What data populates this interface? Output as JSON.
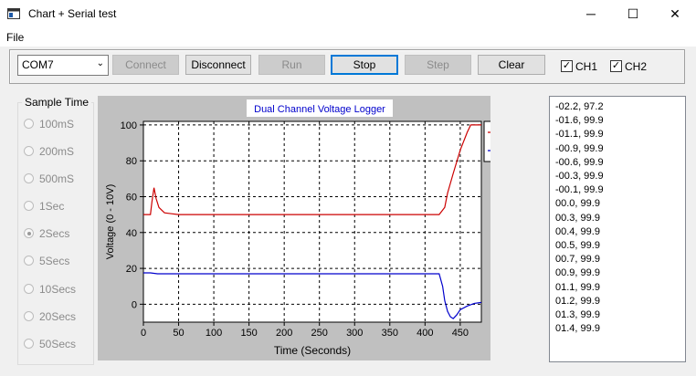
{
  "window": {
    "title": "Chart + Serial test",
    "minimize_glyph": "─",
    "maximize_glyph": "☐",
    "close_glyph": "✕"
  },
  "menu": {
    "file": "File"
  },
  "toolbar": {
    "port_value": "COM7",
    "connect": "Connect",
    "disconnect": "Disconnect",
    "run": "Run",
    "stop": "Stop",
    "step": "Step",
    "clear": "Clear",
    "ch1": "CH1",
    "ch2": "CH2",
    "ch1_checked": true,
    "ch2_checked": true
  },
  "sample_time": {
    "title": "Sample Time",
    "options": [
      "100mS",
      "200mS",
      "500mS",
      "1Sec",
      "2Secs",
      "5Secs",
      "10Secs",
      "20Secs",
      "50Secs"
    ],
    "selected": "2Secs"
  },
  "serial_log": [
    "-02.2, 97.2",
    "-01.6, 99.9",
    "-01.1, 99.9",
    "-00.9, 99.9",
    "-00.6, 99.9",
    "-00.3, 99.9",
    "-00.1, 99.9",
    "00.0, 99.9",
    "00.3, 99.9",
    "00.4, 99.9",
    "00.5, 99.9",
    "00.7, 99.9",
    "00.9, 99.9",
    "01.1, 99.9",
    "01.2, 99.9",
    "01.3, 99.9",
    "01.4, 99.9"
  ],
  "chart_data": {
    "type": "line",
    "title": "Dual Channel Voltage Logger",
    "xlabel": "Time (Seconds)",
    "ylabel": "Voltage (0 - 10V)",
    "xlim": [
      0,
      480
    ],
    "ylim": [
      -10,
      102
    ],
    "x_ticks": [
      0,
      50,
      100,
      150,
      200,
      250,
      300,
      350,
      400,
      450
    ],
    "y_ticks": [
      0,
      20,
      40,
      60,
      80,
      100
    ],
    "grid": true,
    "legend_position": "top-right",
    "series": [
      {
        "name": "CH1",
        "color": "#cc0000",
        "x": [
          0,
          10,
          12,
          15,
          18,
          22,
          30,
          40,
          50,
          100,
          200,
          300,
          420,
          428,
          432,
          440,
          450,
          460,
          465,
          470,
          480
        ],
        "y": [
          50,
          50,
          57,
          65,
          59,
          54,
          51,
          50.5,
          50,
          50,
          50,
          50,
          50,
          54,
          62,
          73,
          86,
          96,
          100,
          100,
          100
        ]
      },
      {
        "name": "CH2",
        "color": "#0000cc",
        "x": [
          0,
          10,
          20,
          50,
          100,
          200,
          300,
          420,
          425,
          428,
          432,
          436,
          440,
          445,
          450,
          460,
          470,
          480
        ],
        "y": [
          17.5,
          17.5,
          17,
          17,
          17,
          17,
          17,
          17,
          10,
          2,
          -4,
          -7,
          -8,
          -6,
          -3,
          -1,
          0.5,
          1
        ]
      }
    ]
  },
  "colors": {
    "ch1": "#cc0000",
    "ch2": "#0000cc",
    "title_text": "#0000cc",
    "focus_border": "#0078d7"
  }
}
